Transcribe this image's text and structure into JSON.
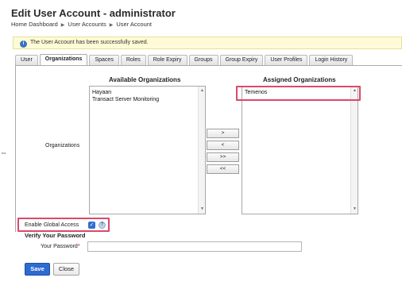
{
  "header": {
    "title": "Edit User Account - administrator",
    "breadcrumb": [
      "Home Dashboard",
      "User Accounts",
      "User Account"
    ]
  },
  "alert": {
    "icon": "info-icon",
    "message": "The User Account has been successfully saved."
  },
  "tabs": [
    {
      "label": "User",
      "active": false
    },
    {
      "label": "Organizations",
      "active": true
    },
    {
      "label": "Spaces",
      "active": false
    },
    {
      "label": "Roles",
      "active": false
    },
    {
      "label": "Role Expiry",
      "active": false
    },
    {
      "label": "Groups",
      "active": false
    },
    {
      "label": "Group Expiry",
      "active": false
    },
    {
      "label": "User Profiles",
      "active": false
    },
    {
      "label": "Login History",
      "active": false
    }
  ],
  "organizations": {
    "field_label": "Organizations",
    "available_heading": "Available Organizations",
    "available": [
      "Hayaan",
      "Transact Server Monitoring"
    ],
    "assigned_heading": "Assigned Organizations",
    "assigned": [
      "Temenos"
    ],
    "buttons": {
      "add": ">",
      "remove": "<",
      "add_all": ">>",
      "remove_all": "<<"
    }
  },
  "global_access": {
    "label": "Enable Global Access",
    "checked": true
  },
  "verify": {
    "section_title": "Verify Your Password",
    "password_label": "Your Password",
    "required_mark": "*",
    "password_value": ""
  },
  "actions": {
    "save_label": "Save",
    "close_label": "Close"
  },
  "colors": {
    "highlight": "#d94a6a",
    "primary": "#2c6bd1",
    "alert_bg": "#fffbd6"
  }
}
